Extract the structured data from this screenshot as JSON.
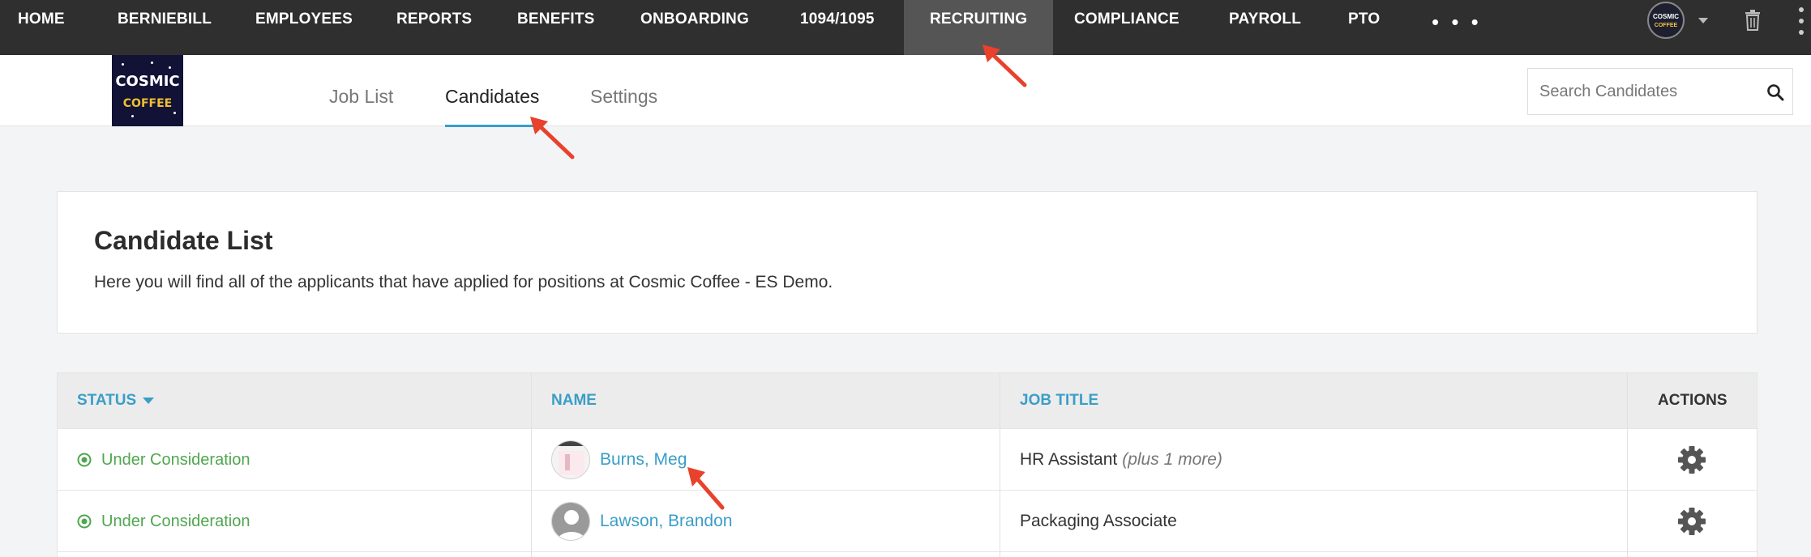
{
  "nav": {
    "items": [
      {
        "label": "HOME"
      },
      {
        "label": "BERNIEBILL"
      },
      {
        "label": "EMPLOYEES"
      },
      {
        "label": "REPORTS"
      },
      {
        "label": "BENEFITS"
      },
      {
        "label": "ONBOARDING"
      },
      {
        "label": "1094/1095"
      },
      {
        "label": "RECRUITING",
        "active": true
      },
      {
        "label": "COMPLIANCE"
      },
      {
        "label": "PAYROLL"
      },
      {
        "label": "PTO"
      }
    ],
    "more_label": "• • •",
    "avatar_text_line1": "COSMIC",
    "avatar_text_line2": "COFFEE"
  },
  "logo": {
    "line1": "COSMIC",
    "line2": "COFFEE"
  },
  "tabs": [
    {
      "label": "Job List"
    },
    {
      "label": "Candidates",
      "active": true
    },
    {
      "label": "Settings"
    }
  ],
  "search": {
    "placeholder": "Search Candidates",
    "value": ""
  },
  "card": {
    "title": "Candidate List",
    "description": "Here you will find all of the applicants that have applied for positions at Cosmic Coffee - ES Demo."
  },
  "table": {
    "columns": {
      "status": "STATUS",
      "name": "NAME",
      "job_title": "JOB TITLE",
      "actions": "ACTIONS"
    },
    "rows": [
      {
        "status": "Under Consideration",
        "name": "Burns, Meg",
        "job_title": "HR Assistant",
        "job_title_extra": "(plus 1 more)"
      },
      {
        "status": "Under Consideration",
        "name": "Lawson, Brandon",
        "job_title": "Packaging Associate",
        "job_title_extra": ""
      }
    ]
  },
  "colors": {
    "nav_bg": "#2f2f2f",
    "nav_active_bg": "#555555",
    "accent": "#3a9ec8",
    "status_green": "#4fa64f",
    "annotation_red": "#e8412c"
  },
  "icons": [
    "trash-icon",
    "kebab-icon",
    "chevron-down-icon",
    "search-icon",
    "status-check-icon",
    "gear-icon",
    "avatar-placeholder-icon",
    "annotation-arrow"
  ]
}
